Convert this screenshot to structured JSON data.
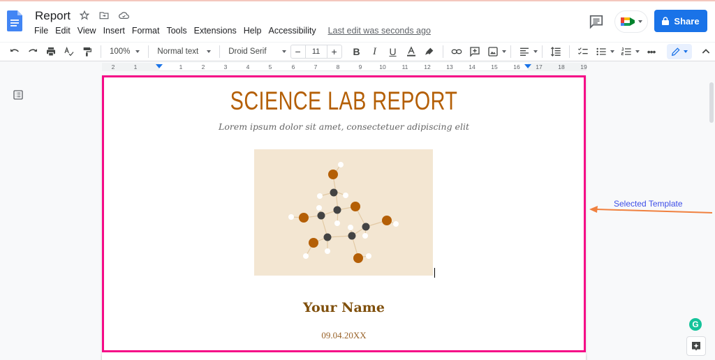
{
  "app": {
    "doc_title": "Report",
    "menu": [
      "File",
      "Edit",
      "View",
      "Insert",
      "Format",
      "Tools",
      "Extensions",
      "Help",
      "Accessibility"
    ],
    "last_edit": "Last edit was seconds ago",
    "share_label": "Share"
  },
  "toolbar": {
    "zoom": "100%",
    "style": "Normal text",
    "font": "Droid Serif",
    "font_size": "11",
    "minus": "−",
    "plus": "+"
  },
  "ruler": {
    "labels": [
      "2",
      "1",
      "1",
      "2",
      "3",
      "4",
      "5",
      "6",
      "7",
      "8",
      "9",
      "10",
      "11",
      "12",
      "13",
      "14",
      "15",
      "16",
      "17",
      "18",
      "19"
    ]
  },
  "document": {
    "title": "SCIENCE LAB REPORT",
    "subtitle": "Lorem ipsum dolor sit amet, consectetuer adipiscing elit",
    "name": "Your Name",
    "date": "09.04.20XX"
  },
  "annotation": {
    "label": "Selected Template",
    "selection_color": "#f50a87",
    "arrow_color": "#f0813f"
  },
  "colors": {
    "accent": "#1a73e8",
    "title": "#b45f06",
    "image_bg": "#f3e6d2"
  }
}
